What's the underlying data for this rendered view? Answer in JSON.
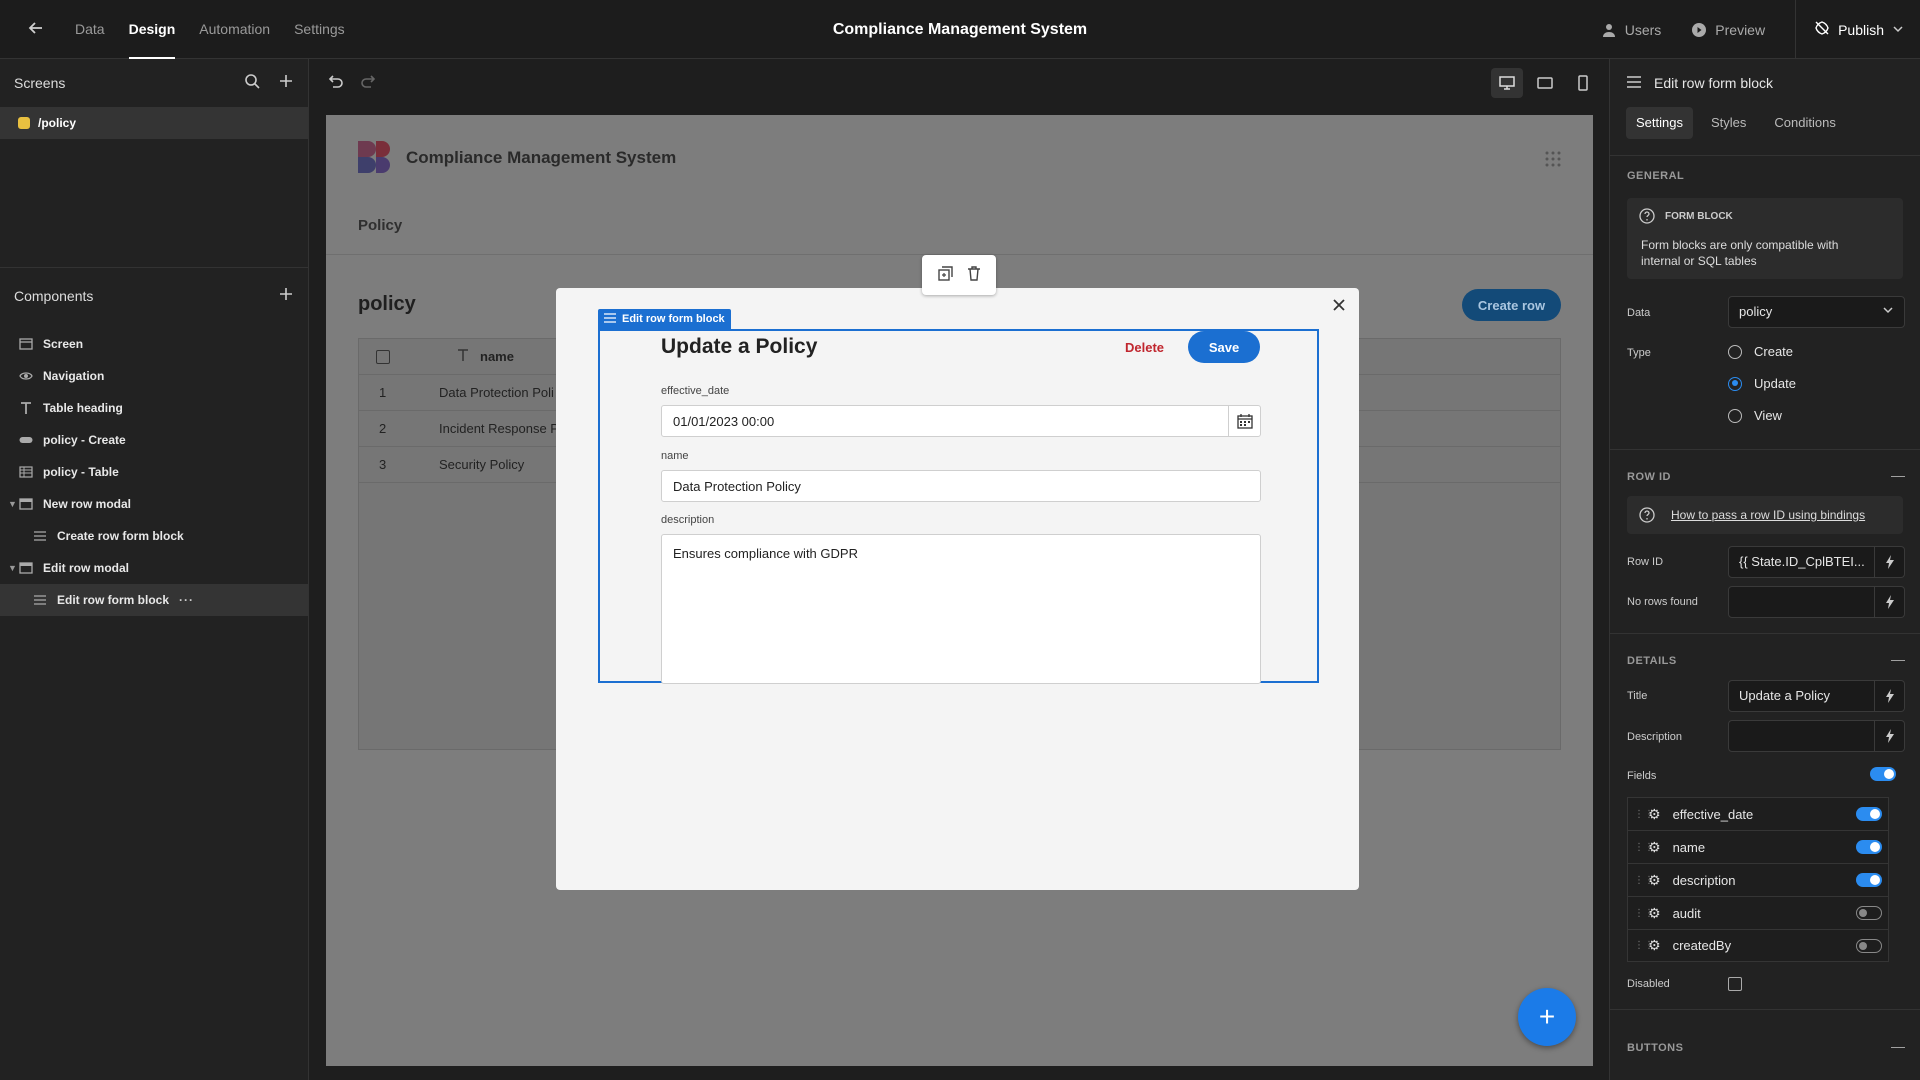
{
  "topbar": {
    "tabs": [
      "Data",
      "Design",
      "Automation",
      "Settings"
    ],
    "app_title": "Compliance Management System",
    "users": "Users",
    "preview": "Preview",
    "publish": "Publish"
  },
  "screens": {
    "title": "Screens",
    "items": [
      "/policy"
    ]
  },
  "components": {
    "title": "Components",
    "items": [
      "Screen",
      "Navigation",
      "Table heading",
      "policy - Create",
      "policy - Table",
      "New row modal",
      "Create row form block",
      "Edit row modal",
      "Edit row form block"
    ],
    "dots": "···"
  },
  "preview": {
    "title": "Compliance Management System",
    "nav_item": "Policy",
    "heading": "policy",
    "create_row": "Create row",
    "table": {
      "column": "name",
      "rows": [
        {
          "num": "1",
          "name": "Data Protection Poli"
        },
        {
          "num": "2",
          "name": "Incident Response P"
        },
        {
          "num": "3",
          "name": "Security Policy"
        }
      ]
    }
  },
  "form": {
    "block_tag": "Edit row form block",
    "title": "Update a Policy",
    "delete": "Delete",
    "save": "Save",
    "fields": {
      "effective_date": {
        "label": "effective_date",
        "value": "01/01/2023 00:00"
      },
      "name": {
        "label": "name",
        "value": "Data Protection Policy"
      },
      "description": {
        "label": "description",
        "value": "Ensures compliance with GDPR"
      }
    }
  },
  "fab_symbol": "+",
  "right": {
    "title": "Edit row form block",
    "tabs": [
      "Settings",
      "Styles",
      "Conditions"
    ],
    "general": {
      "title": "GENERAL",
      "info_title": "FORM BLOCK",
      "info_text": "Form blocks are only compatible with internal or SQL tables",
      "data_label": "Data",
      "data_value": "policy",
      "type_label": "Type",
      "types": [
        "Create",
        "Update",
        "View"
      ],
      "selected_type": "Update"
    },
    "row_id": {
      "title": "ROW ID",
      "link": "How to pass a row ID using bindings",
      "row_id_label": "Row ID",
      "row_id_value": "{{ State.ID_CplBTEI...",
      "no_rows_label": "No rows found",
      "no_rows_value": ""
    },
    "details": {
      "title": "DETAILS",
      "title_label": "Title",
      "title_value": "Update a Policy",
      "description_label": "Description",
      "description_value": "",
      "fields_label": "Fields",
      "fields": [
        {
          "name": "effective_date",
          "on": true
        },
        {
          "name": "name",
          "on": true
        },
        {
          "name": "description",
          "on": true
        },
        {
          "name": "audit",
          "on": false
        },
        {
          "name": "createdBy",
          "on": false
        }
      ],
      "disabled_label": "Disabled"
    },
    "buttons": {
      "title": "BUTTONS"
    }
  },
  "colors": {
    "accent": "#1b6fd1",
    "danger": "#c0262e",
    "screen_dot": "#e9c040"
  }
}
